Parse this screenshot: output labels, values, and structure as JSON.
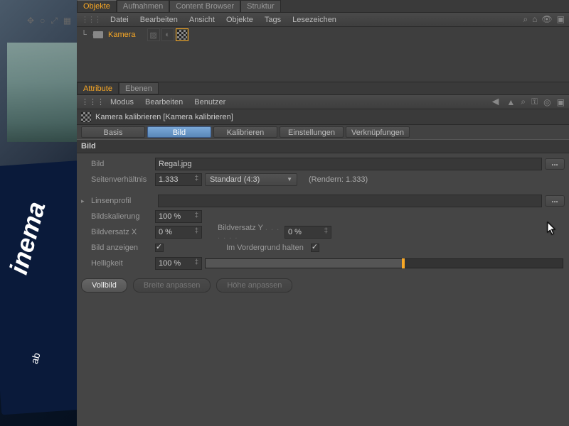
{
  "top_tabs": [
    "Objekte",
    "Aufnahmen",
    "Content Browser",
    "Struktur"
  ],
  "obj_menu": [
    "Datei",
    "Bearbeiten",
    "Ansicht",
    "Objekte",
    "Tags",
    "Lesezeichen"
  ],
  "tree": {
    "camera_label": "Kamera"
  },
  "attr_tabs": [
    "Attribute",
    "Ebenen"
  ],
  "attr_menu": [
    "Modus",
    "Bearbeiten",
    "Benutzer"
  ],
  "obj_header": "Kamera kalibrieren [Kamera kalibrieren]",
  "sub_tabs": [
    "Basis",
    "Bild",
    "Kalibrieren",
    "Einstellungen",
    "Verknüpfungen"
  ],
  "section": "Bild",
  "fields": {
    "bild_label": "Bild",
    "bild_value": "Regal.jpg",
    "aspect_label": "Seitenverhältnis",
    "aspect_value": "1.333",
    "aspect_preset": "Standard (4:3)",
    "render_note": "(Rendern: 1.333)",
    "lens_label": "Linsenprofil",
    "lens_value": "",
    "scale_label": "Bildskalierung",
    "scale_value": "100 %",
    "offx_label": "Bildversatz X",
    "offx_value": "0 %",
    "offy_label": "Bildversatz Y",
    "offy_value": "0 %",
    "show_label": "Bild anzeigen",
    "fg_label": "Im Vordergrund halten",
    "bright_label": "Helligkeit",
    "bright_value": "100 %",
    "bright_pct": 55
  },
  "buttons": {
    "full": "Vollbild",
    "fitw": "Breite anpassen",
    "fith": "Höhe anpassen"
  },
  "viewport_sign": {
    "main": "inema",
    "sub": "ab"
  }
}
